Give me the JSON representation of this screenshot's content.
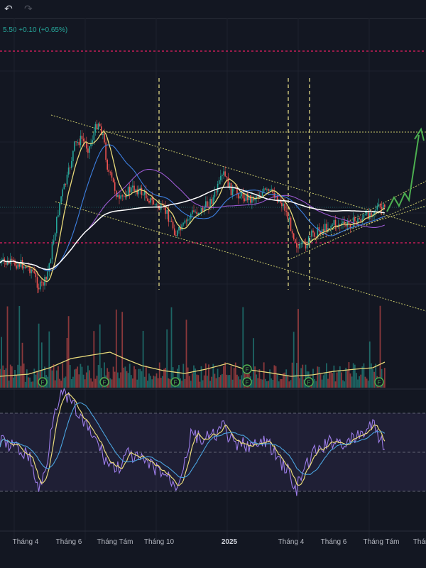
{
  "toolbar": {
    "undo_icon": "undo-arrow-icon",
    "redo_icon": "redo-arrow-icon"
  },
  "header": {
    "price_change": "5.50 +0.10 (+0.65%)"
  },
  "colors": {
    "background": "#131722",
    "up": "#26a69a",
    "down": "#ef5350",
    "ma_fast": "#e8d97a",
    "ma_mid": "#3d7fe0",
    "ma_slow": "#9b59d0",
    "ma_long": "#ffffff",
    "rsi": "#9c7ce8",
    "forecast": "#4caf50",
    "level": "#e91e63",
    "trend": "#c8c86a"
  },
  "chart_data": {
    "type": "line",
    "title": "",
    "x_ticks": [
      "Tháng 4",
      "Tháng 6",
      "Tháng Tám",
      "Tháng 10",
      "2025",
      "Tháng 4",
      "Tháng 6",
      "Tháng Tám",
      "Tháng"
    ],
    "x_tick_bold_index": 4,
    "price_series_note": "",
    "panes": [
      "price",
      "volume",
      "rsi"
    ],
    "earnings_markers": [
      "F",
      "F",
      "F",
      "F",
      "F",
      "F",
      "F"
    ],
    "grid": true
  }
}
